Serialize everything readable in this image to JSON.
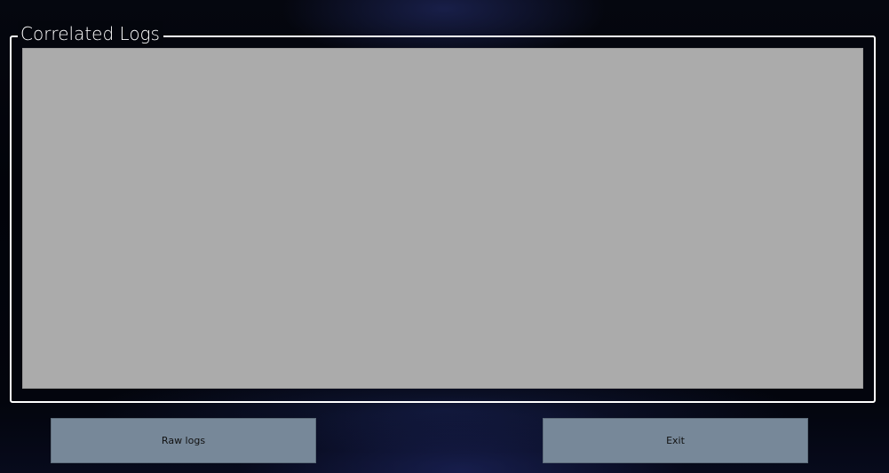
{
  "window": {
    "accent_color": "#778899",
    "panel_color": "#ababab"
  },
  "group": {
    "title": "Correlated Logs"
  },
  "buttons": {
    "raw_logs_label": "Raw logs",
    "exit_label": "Exit"
  }
}
